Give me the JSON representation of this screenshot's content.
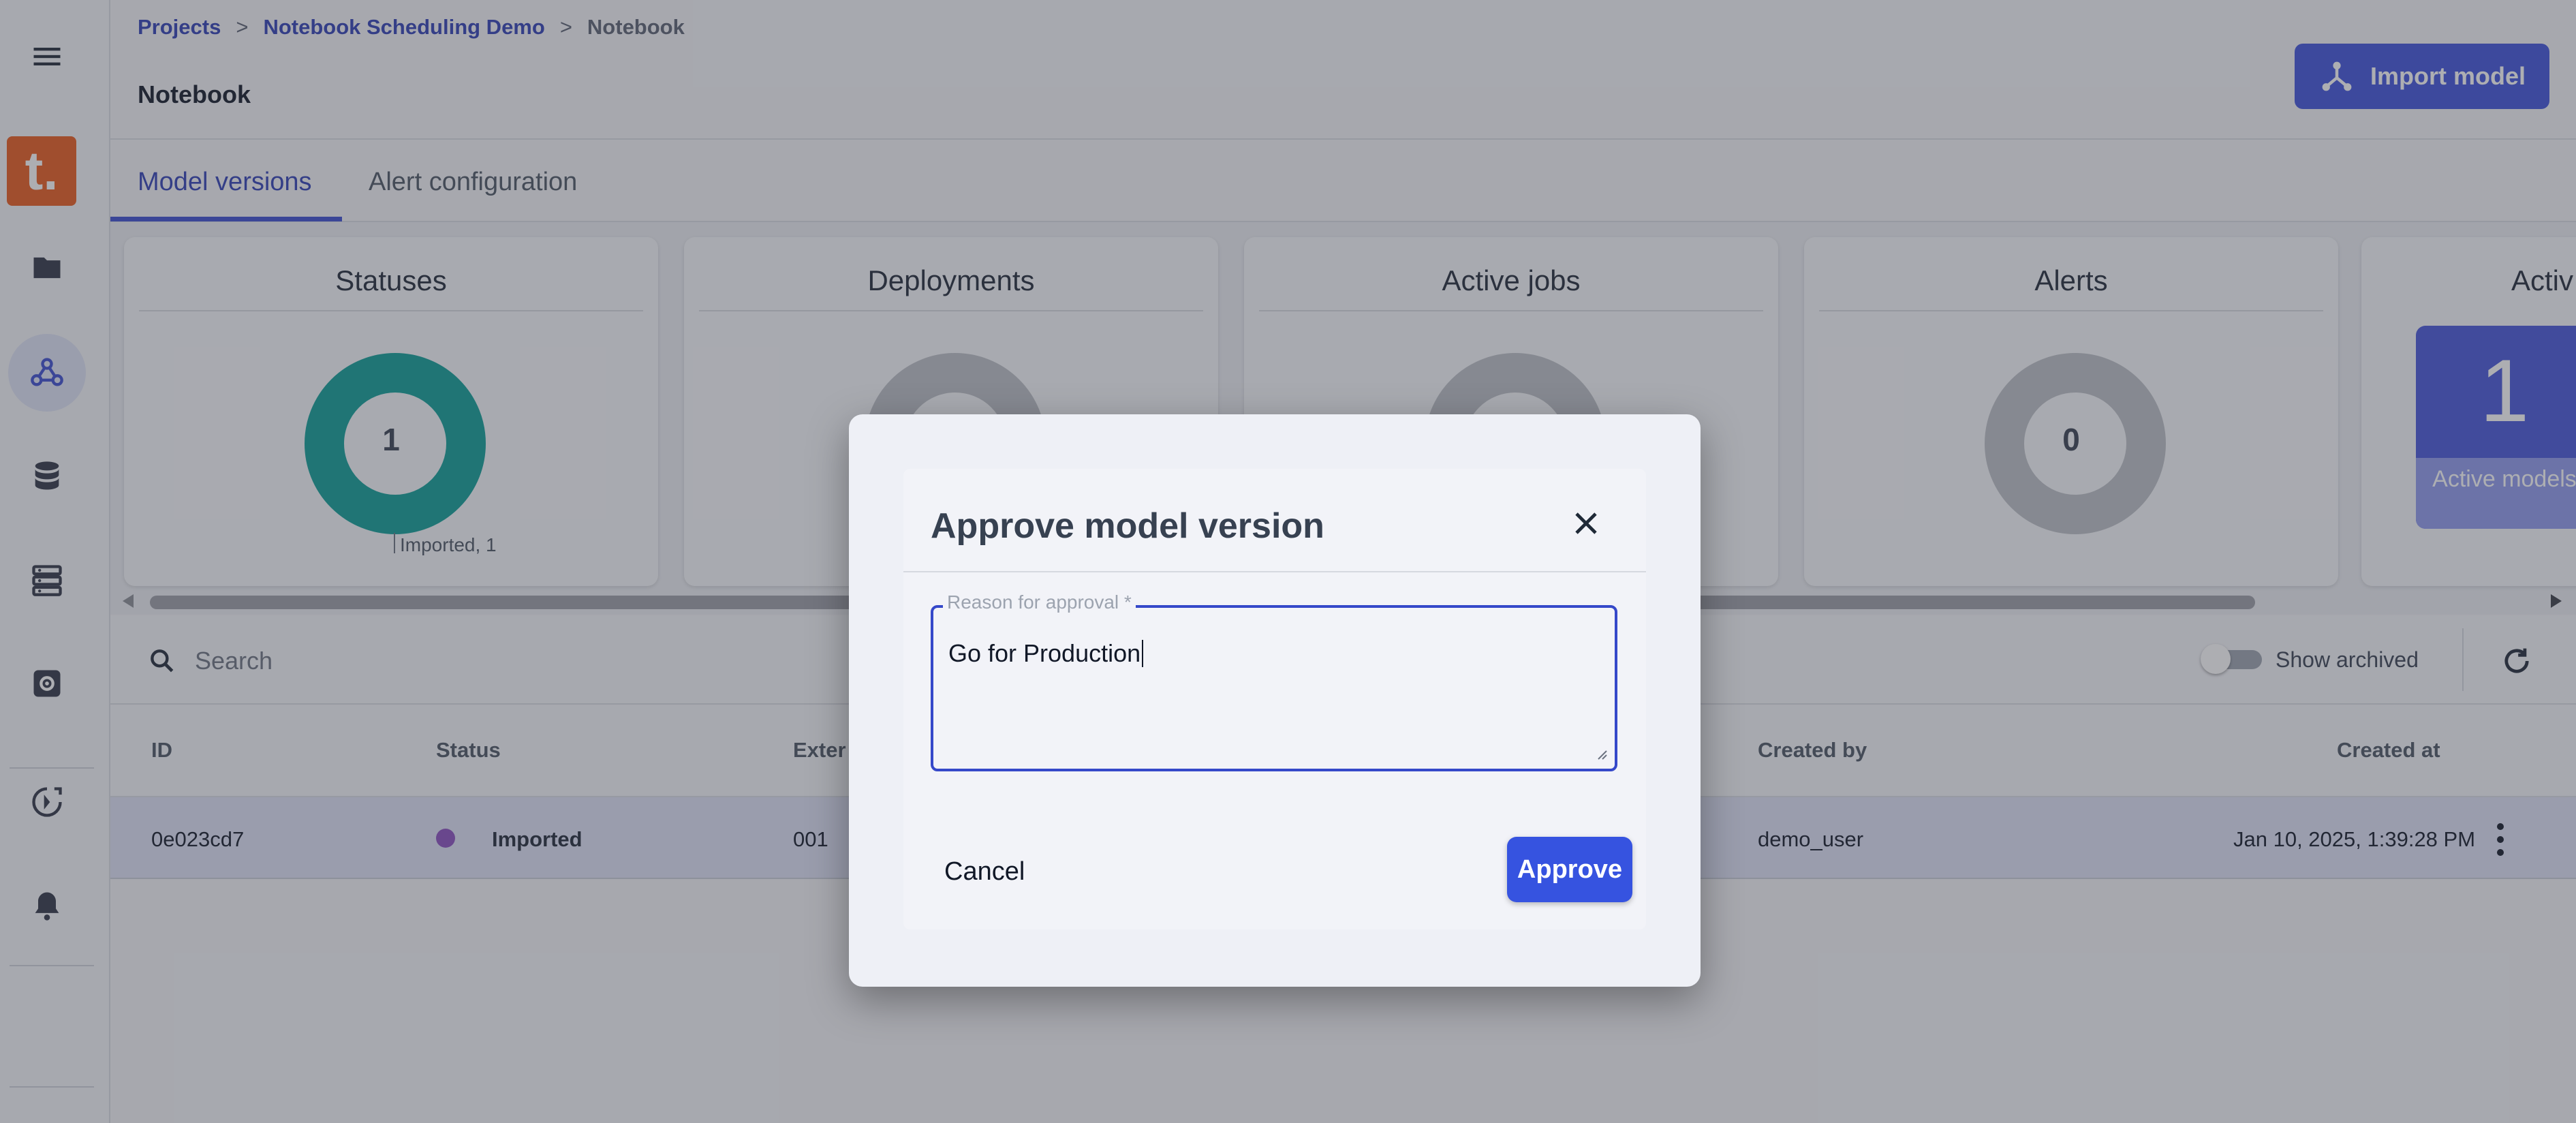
{
  "breadcrumb": {
    "items": [
      "Projects",
      "Notebook Scheduling Demo",
      "Notebook"
    ],
    "separator": ">"
  },
  "page": {
    "title": "Notebook"
  },
  "header": {
    "import_label": "Import model",
    "import_icon": "model-graph-icon"
  },
  "tabs": [
    {
      "label": "Model versions",
      "active": true
    },
    {
      "label": "Alert configuration",
      "active": false
    }
  ],
  "cards": [
    {
      "title": "Statuses",
      "center_value": "1",
      "note": "Imported, 1",
      "color": "#0d9e96"
    },
    {
      "title": "Deployments",
      "color": "#bcc0c6"
    },
    {
      "title": "Active jobs",
      "color": "#bcc0c6"
    },
    {
      "title": "Alerts",
      "center_value": "0",
      "color": "#bcc0c6"
    },
    {
      "title": "Active models",
      "title_visible": "Activ",
      "big_value": "1",
      "sub_label": "Active models"
    }
  ],
  "search": {
    "placeholder": "Search"
  },
  "toolbar": {
    "show_archived_label": "Show archived",
    "show_archived_on": false
  },
  "table": {
    "headers": {
      "id": "ID",
      "status": "Status",
      "external": "Exter",
      "created_by": "Created by",
      "created_at": "Created at"
    },
    "rows": [
      {
        "id": "0e023cd7",
        "status": "Imported",
        "external": "001",
        "created_by": "demo_user",
        "created_at": "Jan 10, 2025, 1:39:28 PM"
      }
    ]
  },
  "dialog": {
    "title": "Approve model version",
    "field_label": "Reason for approval *",
    "field_value": "Go for Production",
    "cancel_label": "Cancel",
    "approve_label": "Approve"
  },
  "colors": {
    "accent": "#3f51db",
    "link": "#2f3fb6",
    "logo": "#e85b1c",
    "status_imported": "#8a4fbf",
    "donut_primary": "#0d9e96",
    "donut_empty": "#bcc0c6"
  }
}
